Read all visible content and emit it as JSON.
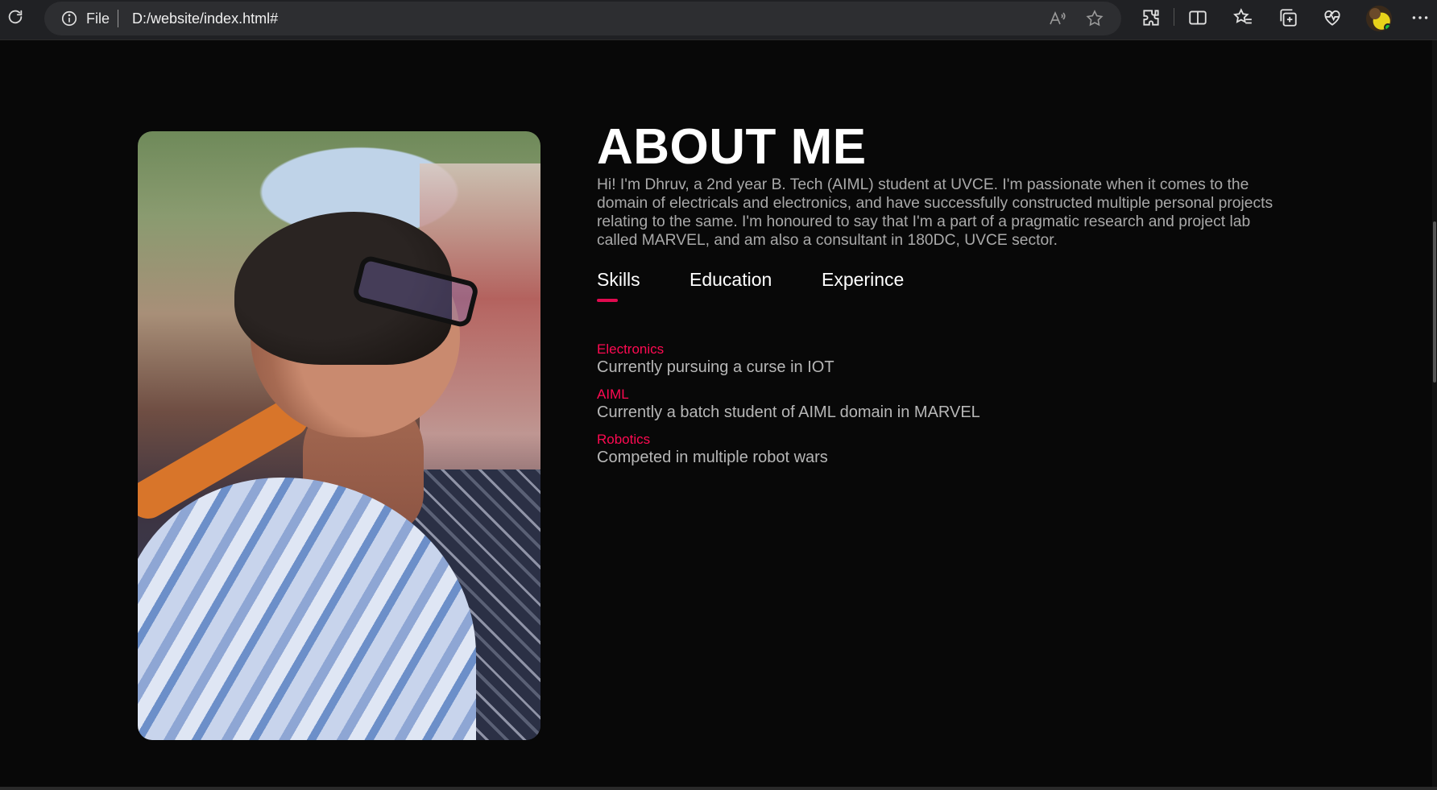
{
  "browser": {
    "scheme_label": "File",
    "url": "D:/website/index.html#",
    "icons": [
      "refresh-icon",
      "info-icon",
      "read-aloud-icon",
      "favorite-star-icon",
      "extensions-icon",
      "split-screen-icon",
      "favorites-icon",
      "collections-icon",
      "browser-essentials-icon",
      "profile-avatar",
      "more-icon"
    ]
  },
  "about": {
    "title": "ABOUT ME",
    "intro": "Hi! I'm Dhruv, a 2nd year B. Tech (AIML) student at UVCE. I'm passionate when it comes to the domain of electricals and electronics, and have successfully constructed multiple personal projects relating to the same. I'm honoured to say that I'm a part of a pragmatic research and project lab called MARVEL, and am also a consultant in 180DC, UVCE sector.",
    "tabs": [
      {
        "label": "Skills",
        "active": true
      },
      {
        "label": "Education",
        "active": false
      },
      {
        "label": "Experince",
        "active": false
      }
    ],
    "skills": [
      {
        "name": "Electronics",
        "desc": "Currently pursuing a curse in IOT"
      },
      {
        "name": "AIML",
        "desc": "Currently a batch student of AIML domain in MARVEL"
      },
      {
        "name": "Robotics",
        "desc": "Competed in multiple robot wars"
      }
    ]
  },
  "colors": {
    "accent": "#ff0a52",
    "background": "#080808",
    "chrome": "#202124"
  }
}
